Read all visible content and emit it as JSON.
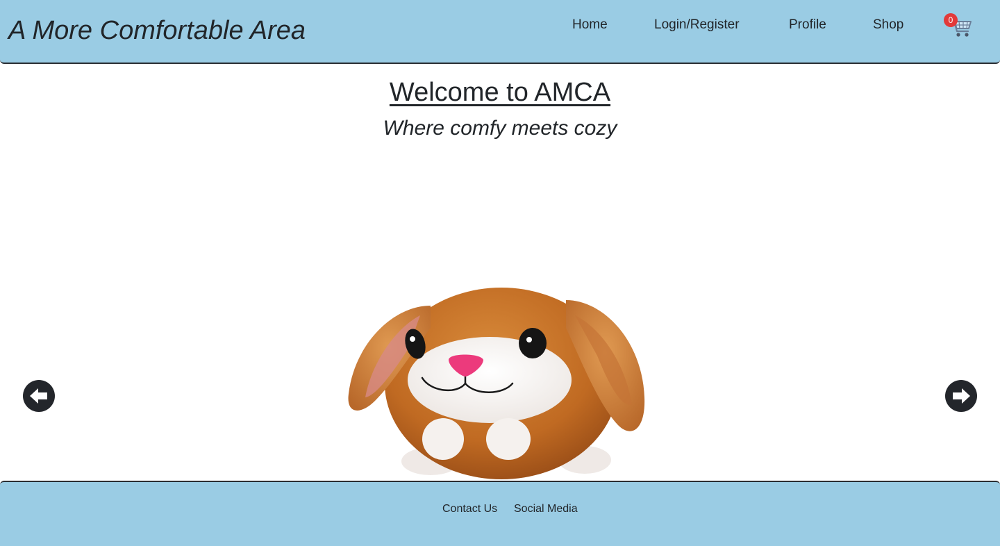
{
  "header": {
    "brand": "A More Comfortable Area",
    "nav": {
      "home": "Home",
      "login": "Login/Register",
      "profile": "Profile",
      "shop": "Shop"
    },
    "cart": {
      "icon": "shopping-cart-icon",
      "count": "0"
    }
  },
  "main": {
    "title": "Welcome to AMCA",
    "tagline": "Where comfy meets cozy",
    "carousel": {
      "image_subject": "orange plush bunny toy",
      "prev_icon": "arrow-left-circle-icon",
      "next_icon": "arrow-right-circle-icon"
    }
  },
  "footer": {
    "contact": "Contact Us",
    "social": "Social Media"
  },
  "colors": {
    "header_bg": "#9acce4",
    "footer_bg": "#9acce4",
    "badge": "#e23a3a",
    "arrow": "#23262b",
    "text": "#212529"
  }
}
